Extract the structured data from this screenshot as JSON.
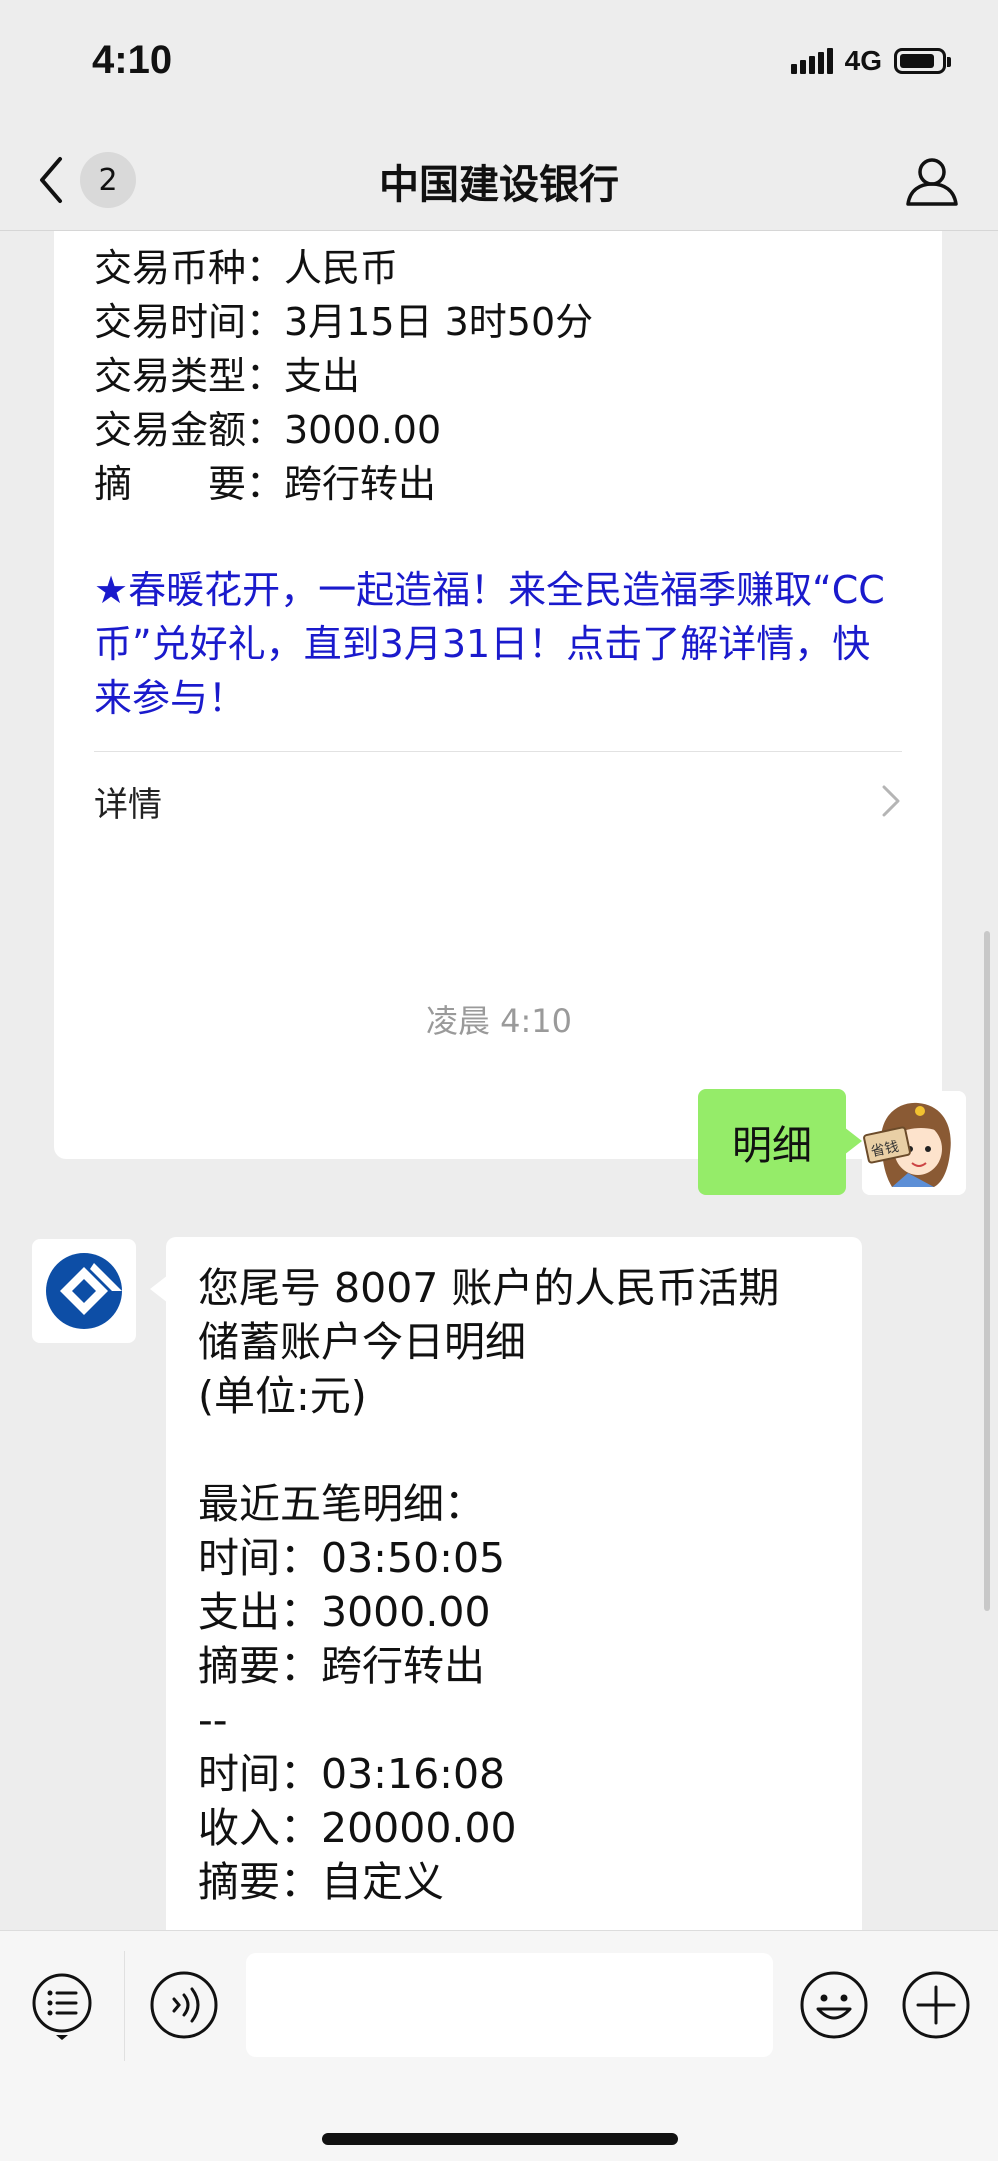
{
  "status_bar": {
    "time": "4:10",
    "network": "4G"
  },
  "nav": {
    "badge_count": "2",
    "title": "中国建设银行"
  },
  "card": {
    "lines": [
      "交易币种：人民币",
      "交易时间：3月15日 3时50分",
      "交易类型：支出",
      "交易金额：3000.00",
      "摘　　要：跨行转出"
    ],
    "promo": "★春暖花开，一起造福！来全民造福季赚取“CC币”兑好礼，直到3月31日！点击了解详情，快来参与！",
    "details_label": "详情"
  },
  "timestamp": "凌晨 4:10",
  "user_message": "明细",
  "user_avatar_stamp": "省钱",
  "bank_message": {
    "lines": [
      "您尾号 8007 账户的人民币活期",
      "储蓄账户今日明细",
      "(单位:元)",
      "",
      "最近五笔明细：",
      "时间：03:50:05",
      "支出：3000.00",
      "摘要：跨行转出",
      "--",
      "时间：03:16:08",
      "收入：20000.00",
      "摘要：自定义"
    ]
  },
  "input": {
    "placeholder": ""
  },
  "colors": {
    "bubble_user": "#95ec69",
    "promo_text": "#1a1acc",
    "bank_logo": "#0d4ea6"
  }
}
